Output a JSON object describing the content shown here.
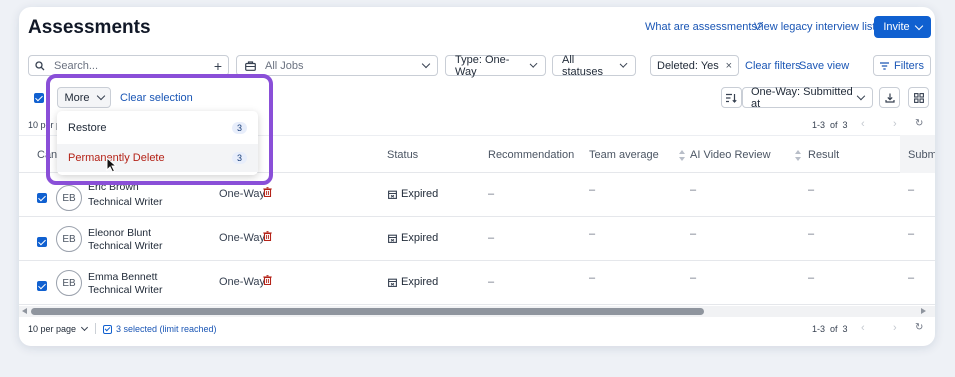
{
  "header": {
    "title": "Assessments",
    "what_are_link": "What are assessments?",
    "legacy_link": "View legacy interview list",
    "invite_label": "Invite"
  },
  "filters": {
    "search_placeholder": "Search...",
    "jobs_value": "All Jobs",
    "type_value": "Type: One-Way",
    "status_value": "All statuses",
    "deleted_chip": "Deleted: Yes",
    "clear_filters": "Clear filters",
    "save_view": "Save view",
    "filters_button": "Filters"
  },
  "toolbar": {
    "more_label": "More",
    "clear_selection": "Clear selection",
    "sort_value": "One-Way: Submitted at",
    "per_page_partial": "10 per pa"
  },
  "pagination_top": {
    "range": "1-3",
    "of": "of",
    "total": "3"
  },
  "dropdown": {
    "items": [
      {
        "label": "Restore",
        "count": "3"
      },
      {
        "label": "Permanently Delete",
        "count": "3"
      }
    ]
  },
  "table": {
    "columns": {
      "candidate": "Canc",
      "status": "Status",
      "recommendation": "Recommendation",
      "team_average": "Team average",
      "ai_video_review": "AI Video Review",
      "result": "Result",
      "submitted": "Subm"
    },
    "rows": [
      {
        "initials": "EB",
        "name": "Eric Brown",
        "role": "Technical Writer",
        "type": "One-Way",
        "status": "Expired",
        "recommendation": "–",
        "team_average": "–",
        "ai_review": "–",
        "result": "–",
        "submitted": "–"
      },
      {
        "initials": "EB",
        "name": "Eleonor Blunt",
        "role": "Technical Writer",
        "type": "One-Way",
        "status": "Expired",
        "recommendation": "–",
        "team_average": "–",
        "ai_review": "–",
        "result": "–",
        "submitted": "–"
      },
      {
        "initials": "EB",
        "name": "Emma Bennett",
        "role": "Technical Writer",
        "type": "One-Way",
        "status": "Expired",
        "recommendation": "–",
        "team_average": "–",
        "ai_review": "–",
        "result": "–",
        "submitted": "–"
      }
    ]
  },
  "footer": {
    "per_page": "10 per page",
    "selected": "3 selected (limit reached)",
    "range": "1-3",
    "of": "of",
    "total": "3"
  },
  "colors": {
    "primary": "#1060d0",
    "highlight": "#8a4fd8",
    "danger": "#b42318"
  }
}
